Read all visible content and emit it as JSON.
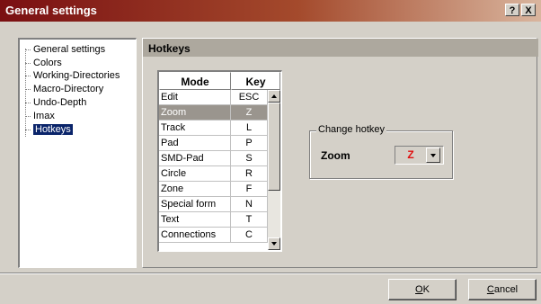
{
  "window": {
    "title": "General settings",
    "help_button": "?",
    "close_button": "X"
  },
  "tree": {
    "items": [
      {
        "label": "General settings"
      },
      {
        "label": "Colors"
      },
      {
        "label": "Working-Directories"
      },
      {
        "label": "Macro-Directory"
      },
      {
        "label": "Undo-Depth"
      },
      {
        "label": "Imax"
      },
      {
        "label": "Hotkeys",
        "selected": true
      }
    ]
  },
  "panel": {
    "title": "Hotkeys"
  },
  "grid": {
    "headers": {
      "mode": "Mode",
      "key": "Key"
    },
    "rows": [
      {
        "mode": "Edit",
        "key": "ESC"
      },
      {
        "mode": "Zoom",
        "key": "Z",
        "selected": true
      },
      {
        "mode": "Track",
        "key": "L"
      },
      {
        "mode": "Pad",
        "key": "P"
      },
      {
        "mode": "SMD-Pad",
        "key": "S"
      },
      {
        "mode": "Circle",
        "key": "R"
      },
      {
        "mode": "Zone",
        "key": "F"
      },
      {
        "mode": "Special form",
        "key": "N"
      },
      {
        "mode": "Text",
        "key": "T"
      },
      {
        "mode": "Connections",
        "key": "C"
      }
    ]
  },
  "change_hotkey": {
    "group_label": "Change hotkey",
    "mode_label": "Zoom",
    "key_value": "Z",
    "key_color": "#e01010"
  },
  "buttons": {
    "ok_underlined": "O",
    "ok_rest": "K",
    "cancel_underlined": "C",
    "cancel_rest": "ancel"
  },
  "colors": {
    "title_gradient_start": "#7a0f12",
    "panel_header": "#ada89e",
    "selected_row": "#9a958e",
    "tree_selection": "#0a246a"
  }
}
